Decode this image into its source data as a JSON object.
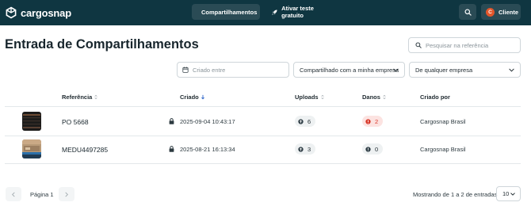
{
  "brand": {
    "name": "cargosnap"
  },
  "topnav": {
    "shares_label": "Compartilhamentos",
    "trial_label": "Ativar teste gratuito",
    "user_initial": "C",
    "user_label": "Cliente"
  },
  "page": {
    "title": "Entrada de Compartilhamentos",
    "search_placeholder": "Pesquisar na referência"
  },
  "filters": {
    "date_placeholder": "Criado entre",
    "shared_value": "Compartilhado com a minha empresa",
    "company_value": "De qualquer empresa"
  },
  "table": {
    "columns": {
      "reference": "Referência",
      "created": "Criado",
      "uploads": "Uploads",
      "damages": "Danos",
      "created_by": "Criado por"
    },
    "rows": [
      {
        "reference": "PO 5668",
        "created": "2025-09-04 10:43:17",
        "uploads": "6",
        "damages": "2",
        "created_by": "Cargosnap Brasil"
      },
      {
        "reference": "MEDU4497285",
        "created": "2025-08-21 16:13:34",
        "uploads": "3",
        "damages": "0",
        "created_by": "Cargosnap Brasil"
      }
    ]
  },
  "footer": {
    "page_label": "Página 1",
    "showing": "Mostrando de 1 a 2 de entradas",
    "per_page": "10"
  },
  "colors": {
    "topbar": "#0f3641",
    "accent_orange": "#e2562b",
    "danger": "#d93a2c"
  }
}
